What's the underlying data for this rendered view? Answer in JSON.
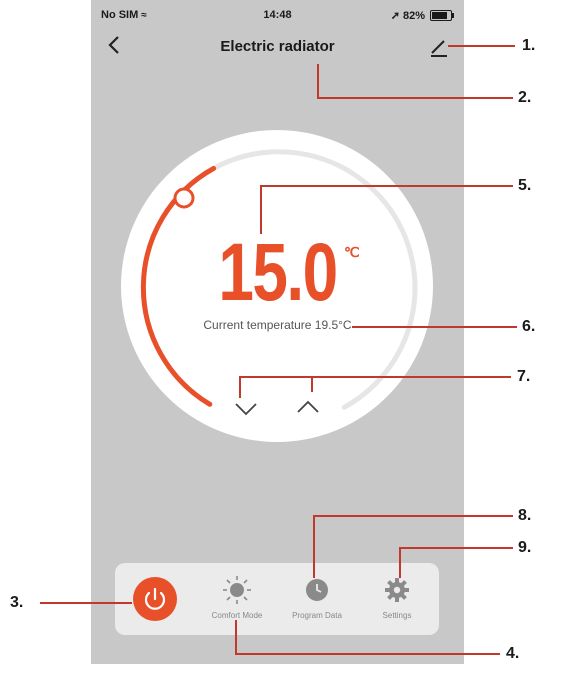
{
  "status_bar": {
    "carrier": "No SIM",
    "time": "14:48",
    "battery": "82%",
    "battery_level": 0.82
  },
  "header": {
    "title": "Electric radiator",
    "back_icon": "chevron-left-icon",
    "edit_icon": "pencil-icon"
  },
  "thermostat": {
    "set_temperature": "15.0",
    "unit": "℃",
    "current_temperature_text": "Current temperature 19.5°C",
    "decrease_icon": "chevron-down-icon",
    "increase_icon": "chevron-up-icon"
  },
  "toolbar": {
    "power_icon": "power-icon",
    "items": [
      {
        "label": "Comfort Mode",
        "icon": "sun-icon"
      },
      {
        "label": "Program Data",
        "icon": "clock-icon"
      },
      {
        "label": "Settings",
        "icon": "gear-icon"
      }
    ]
  },
  "annotations": [
    "1.",
    "2.",
    "3.",
    "4.",
    "5.",
    "6.",
    "7.",
    "8.",
    "9."
  ],
  "colors": {
    "accent": "#e8502a",
    "screen_background": "#c8c8c8",
    "toolbar_background": "#ebebeb",
    "callout_line": "#c0392b"
  }
}
